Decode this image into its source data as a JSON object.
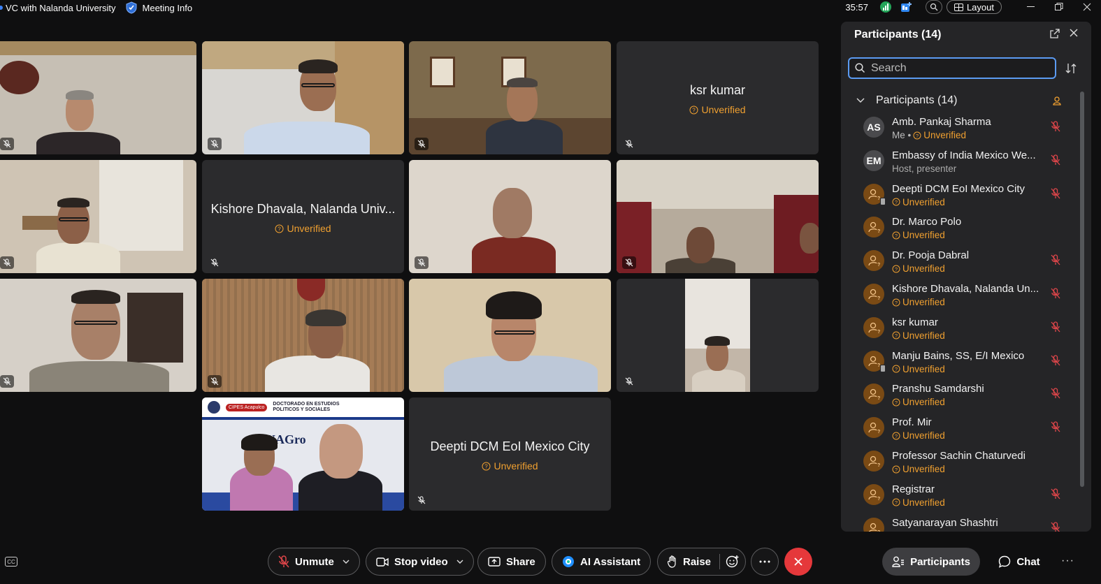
{
  "titlebar": {
    "app_title": "VC with Nalanda University",
    "meeting_info": "Meeting Info",
    "timer": "35:57",
    "layout_label": "Layout"
  },
  "tiles": {
    "ksr_name": "ksr kumar",
    "kishore_name": "Kishore Dhavala, Nalanda Univ...",
    "deepti_name": "Deepti DCM EoI Mexico City",
    "unverified": "Unverified",
    "uag_banner_left": "CIPES Acapulco",
    "uag_banner_mid": "DOCTORADO EN ESTUDIOS POLITICOS Y SOCIALES",
    "uag_logo": "UAGro"
  },
  "panel": {
    "title": "Participants (14)",
    "search_placeholder": "Search",
    "group_label": "Participants (14)",
    "participants": [
      {
        "name": "Amb. Pankaj Sharma",
        "initials": "AS",
        "avatar": "initials",
        "me": "Me •",
        "sub": "Unverified",
        "sub_type": "unverified",
        "muted": true
      },
      {
        "name": "Embassy of India Mexico We...",
        "initials": "EM",
        "avatar": "initials",
        "sub": "Host, presenter",
        "sub_type": "role",
        "muted": true
      },
      {
        "name": "Deepti DCM EoI Mexico City",
        "avatar": "guest-phone",
        "sub": "Unverified",
        "sub_type": "unverified",
        "muted": true
      },
      {
        "name": "Dr. Marco Polo",
        "avatar": "guest",
        "sub": "Unverified",
        "sub_type": "unverified",
        "muted": false
      },
      {
        "name": "Dr. Pooja Dabral",
        "avatar": "guest",
        "sub": "Unverified",
        "sub_type": "unverified",
        "muted": true
      },
      {
        "name": "Kishore Dhavala, Nalanda Un...",
        "avatar": "guest",
        "sub": "Unverified",
        "sub_type": "unverified",
        "muted": true
      },
      {
        "name": "ksr kumar",
        "avatar": "guest",
        "sub": "Unverified",
        "sub_type": "unverified",
        "muted": true
      },
      {
        "name": "Manju Bains, SS, E/I Mexico",
        "avatar": "guest-phone",
        "sub": "Unverified",
        "sub_type": "unverified",
        "muted": true
      },
      {
        "name": "Pranshu Samdarshi",
        "avatar": "guest",
        "sub": "Unverified",
        "sub_type": "unverified",
        "muted": true
      },
      {
        "name": "Prof. Mir",
        "avatar": "guest",
        "sub": "Unverified",
        "sub_type": "unverified",
        "muted": true
      },
      {
        "name": "Professor Sachin Chaturvedi",
        "avatar": "guest",
        "sub": "Unverified",
        "sub_type": "unverified",
        "muted": false
      },
      {
        "name": "Registrar",
        "avatar": "guest",
        "sub": "Unverified",
        "sub_type": "unverified",
        "muted": true
      },
      {
        "name": "Satyanarayan Shashtri",
        "avatar": "guest",
        "sub": "Unverified",
        "sub_type": "unverified",
        "muted": true
      }
    ]
  },
  "controls": {
    "unmute": "Unmute",
    "stop_video": "Stop video",
    "share": "Share",
    "ai_assistant": "AI Assistant",
    "raise": "Raise",
    "participants": "Participants",
    "chat": "Chat"
  },
  "colors": {
    "unverified": "#f0a030",
    "end_call": "#e5383b",
    "search_focus": "#5b9bf2",
    "mute_red": "#e0464a"
  }
}
